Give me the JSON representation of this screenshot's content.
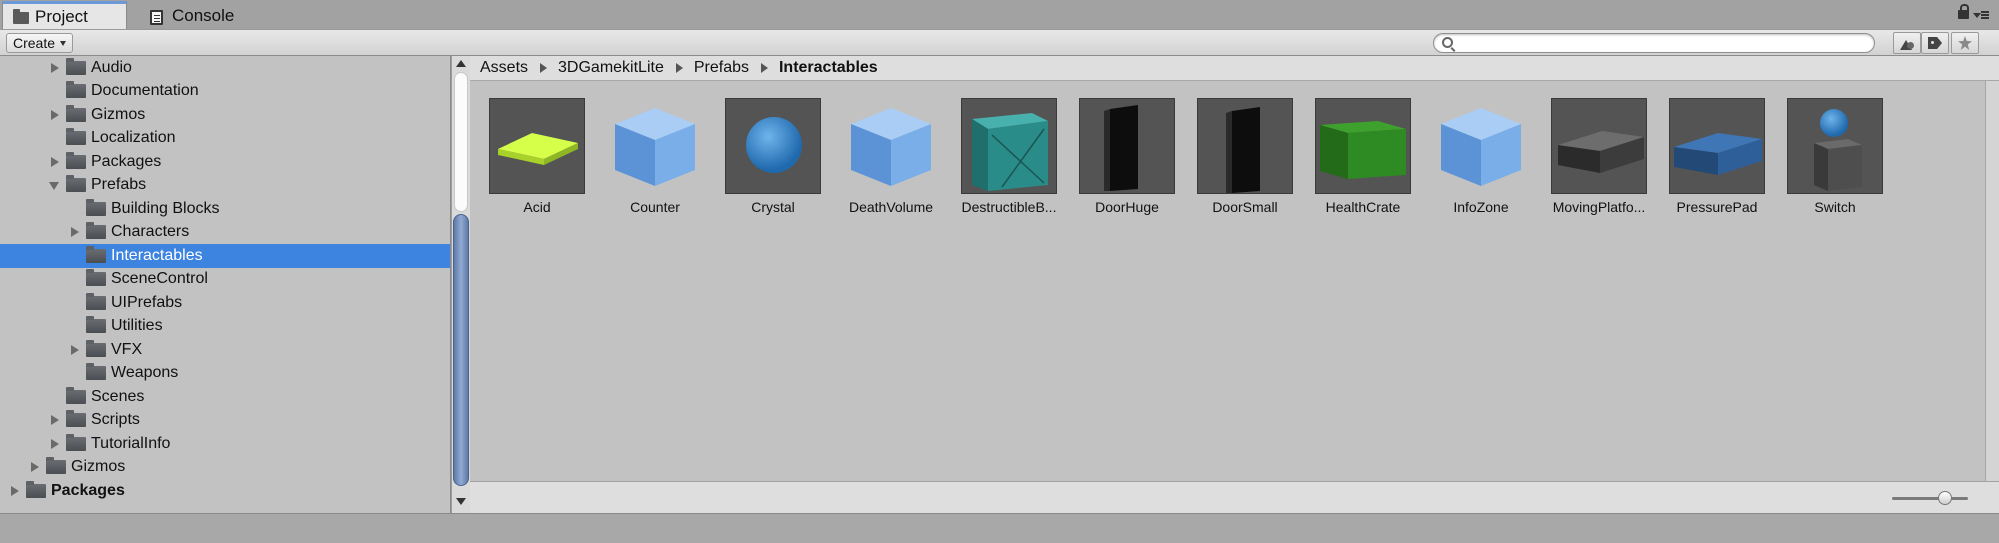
{
  "tabs": [
    {
      "label": "Project",
      "icon": "folder-icon",
      "active": true
    },
    {
      "label": "Console",
      "icon": "console-icon",
      "active": false
    }
  ],
  "toolbar": {
    "create_label": "Create",
    "search": {
      "value": "",
      "placeholder": ""
    }
  },
  "sidebar": {
    "items": [
      {
        "label": "Audio",
        "expandable": true,
        "expanded": false
      },
      {
        "label": "Documentation",
        "expandable": false
      },
      {
        "label": "Gizmos",
        "expandable": true,
        "expanded": false
      },
      {
        "label": "Localization",
        "expandable": false
      },
      {
        "label": "Packages",
        "expandable": true,
        "expanded": false
      },
      {
        "label": "Prefabs",
        "expandable": true,
        "expanded": true
      },
      {
        "label": "Building Blocks",
        "expandable": false
      },
      {
        "label": "Characters",
        "expandable": true,
        "expanded": false
      },
      {
        "label": "Interactables",
        "expandable": false,
        "selected": true
      },
      {
        "label": "SceneControl",
        "expandable": false
      },
      {
        "label": "UIPrefabs",
        "expandable": false
      },
      {
        "label": "Utilities",
        "expandable": false
      },
      {
        "label": "VFX",
        "expandable": true,
        "expanded": false
      },
      {
        "label": "Weapons",
        "expandable": false
      },
      {
        "label": "Scenes",
        "expandable": false
      },
      {
        "label": "Scripts",
        "expandable": true,
        "expanded": false
      },
      {
        "label": "TutorialInfo",
        "expandable": true,
        "expanded": false
      },
      {
        "label": "Gizmos",
        "expandable": true,
        "expanded": false
      },
      {
        "label": "Packages",
        "expandable": true,
        "expanded": false
      }
    ]
  },
  "breadcrumb": [
    "Assets",
    "3DGamekitLite",
    "Prefabs",
    "Interactables"
  ],
  "assets": [
    {
      "label": "Acid",
      "icon": "acid-slab-icon"
    },
    {
      "label": "Counter",
      "icon": "blue-cube-icon"
    },
    {
      "label": "Crystal",
      "icon": "blue-sphere-icon"
    },
    {
      "label": "DeathVolume",
      "icon": "blue-cube-icon"
    },
    {
      "label": "DestructibleB...",
      "icon": "teal-crate-icon"
    },
    {
      "label": "DoorHuge",
      "icon": "black-door-icon"
    },
    {
      "label": "DoorSmall",
      "icon": "black-door-icon"
    },
    {
      "label": "HealthCrate",
      "icon": "green-crate-icon"
    },
    {
      "label": "InfoZone",
      "icon": "blue-cube-icon"
    },
    {
      "label": "MovingPlatfo...",
      "icon": "grey-platform-icon"
    },
    {
      "label": "PressurePad",
      "icon": "blue-pad-icon"
    },
    {
      "label": "Switch",
      "icon": "switch-icon"
    }
  ],
  "colors": {
    "selection": "#3d83e0",
    "acid": "#c6f53a",
    "cube": "#6aa0e0",
    "crate_teal": "#2a8c88",
    "crate_green": "#2e8a22",
    "pad_blue": "#2f5f98"
  }
}
